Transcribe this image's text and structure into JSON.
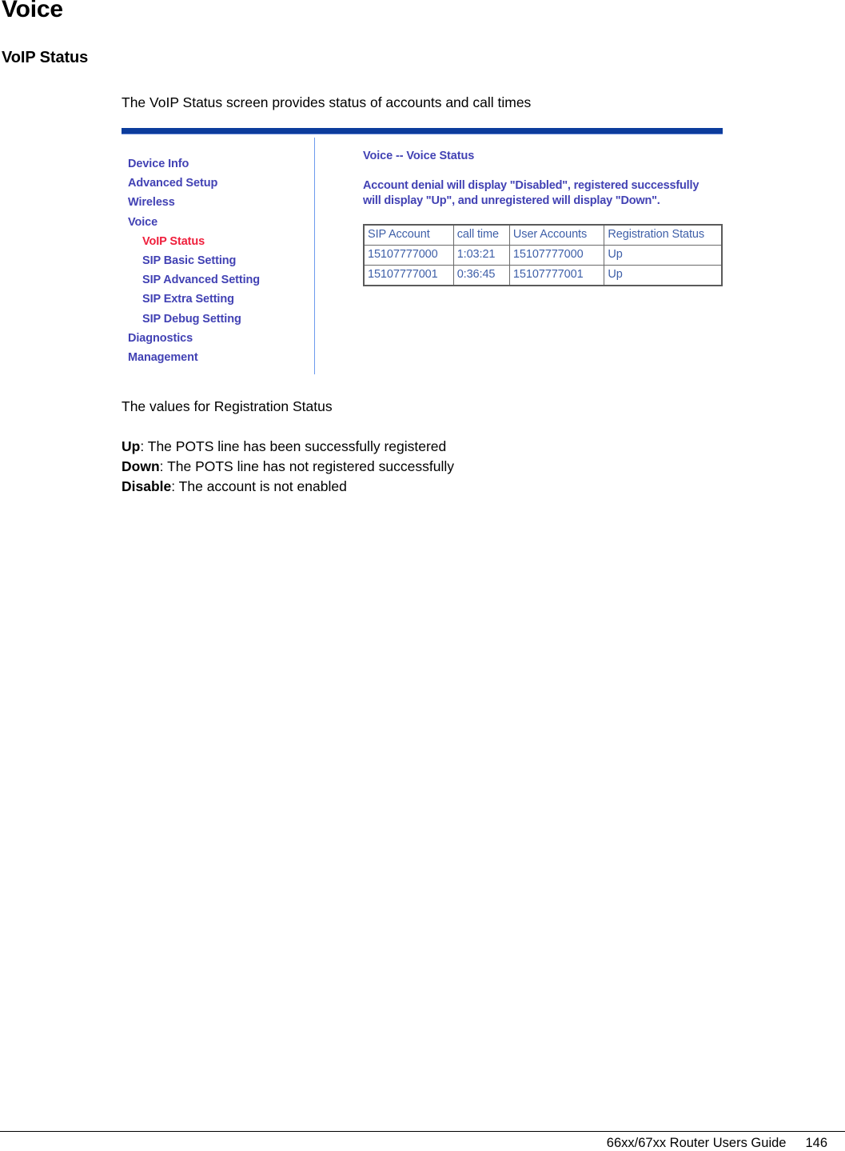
{
  "page": {
    "heading": "Voice",
    "subheading": "VoIP Status",
    "intro_paragraph": "The VoIP Status screen provides status of accounts and call times",
    "values_paragraph": "The values for Registration Status"
  },
  "definitions": [
    {
      "term": "Up",
      "separator": ": ",
      "description": "The POTS line has been successfully registered"
    },
    {
      "term": "Down",
      "separator": ": ",
      "description": "The POTS line has not registered successfully"
    },
    {
      "term": "Disable",
      "separator": ": ",
      "description": "The account is not enabled"
    }
  ],
  "screenshot": {
    "sidebar": {
      "items": [
        {
          "label": "Device Info",
          "level": 0,
          "active": false
        },
        {
          "label": "Advanced Setup",
          "level": 0,
          "active": false
        },
        {
          "label": "Wireless",
          "level": 0,
          "active": false
        },
        {
          "label": "Voice",
          "level": 0,
          "active": false
        },
        {
          "label": "VoIP Status",
          "level": 1,
          "active": true
        },
        {
          "label": "SIP Basic Setting",
          "level": 1,
          "active": false
        },
        {
          "label": "SIP Advanced Setting",
          "level": 1,
          "active": false
        },
        {
          "label": "SIP Extra Setting",
          "level": 1,
          "active": false
        },
        {
          "label": "SIP Debug Setting",
          "level": 1,
          "active": false
        },
        {
          "label": "Diagnostics",
          "level": 0,
          "active": false
        },
        {
          "label": "Management",
          "level": 0,
          "active": false
        }
      ]
    },
    "main": {
      "title": "Voice -- Voice Status",
      "description": "Account denial will display \"Disabled\", registered successfully will display \"Up\", and unregistered will display \"Down\".",
      "table": {
        "headers": [
          "SIP Account",
          "call time",
          "User Accounts",
          "Registration Status"
        ],
        "rows": [
          [
            "15107777000",
            "1:03:21",
            "15107777000",
            "Up"
          ],
          [
            "15107777001",
            "0:36:45",
            "15107777001",
            "Up"
          ]
        ]
      }
    },
    "colors": {
      "topbar": "#0c3c9c",
      "nav_link": "#4242b4",
      "nav_active": "#ef1f3c",
      "table_text": "#3e5fa8",
      "divider": "#6d9aee"
    }
  },
  "footer": {
    "guide": "66xx/67xx Router Users Guide",
    "page_number": "146"
  }
}
